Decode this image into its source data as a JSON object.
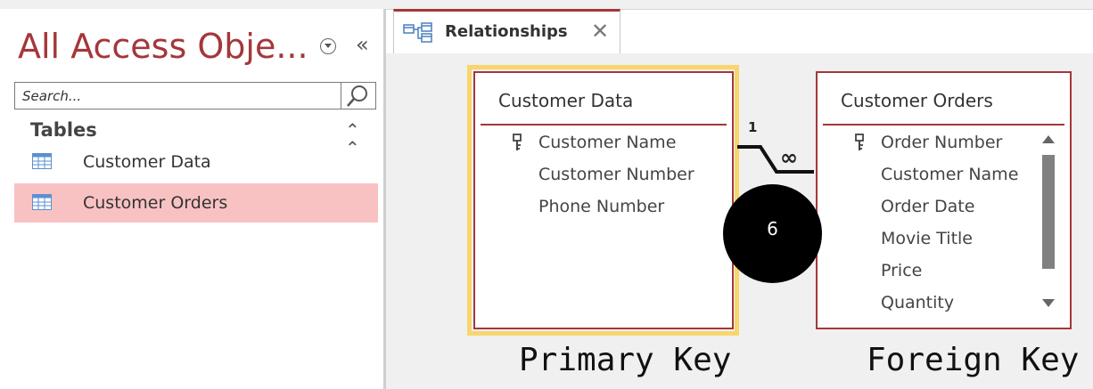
{
  "nav": {
    "title": "All Access Obje...",
    "search_placeholder": "Search...",
    "group_header": "Tables",
    "items": [
      {
        "label": "Customer Data",
        "selected": false
      },
      {
        "label": "Customer Orders",
        "selected": true
      }
    ]
  },
  "tab": {
    "label": "Relationships"
  },
  "tables": {
    "customer_data": {
      "title": "Customer Data",
      "fields": [
        "Customer Name",
        "Customer Number",
        "Phone Number"
      ]
    },
    "customer_orders": {
      "title": "Customer Orders",
      "fields": [
        "Order Number",
        "Customer Name",
        "Order Date",
        "Movie Title",
        "Price",
        "Quantity"
      ]
    }
  },
  "relationship": {
    "one_label": "1",
    "many_label": "∞"
  },
  "badge": "6",
  "captions": {
    "primary": "Primary Key",
    "foreign": "Foreign Key"
  },
  "colors": {
    "accent": "#a4373a",
    "selected_bg": "#f9c2c2",
    "highlight": "#f7d66d"
  }
}
